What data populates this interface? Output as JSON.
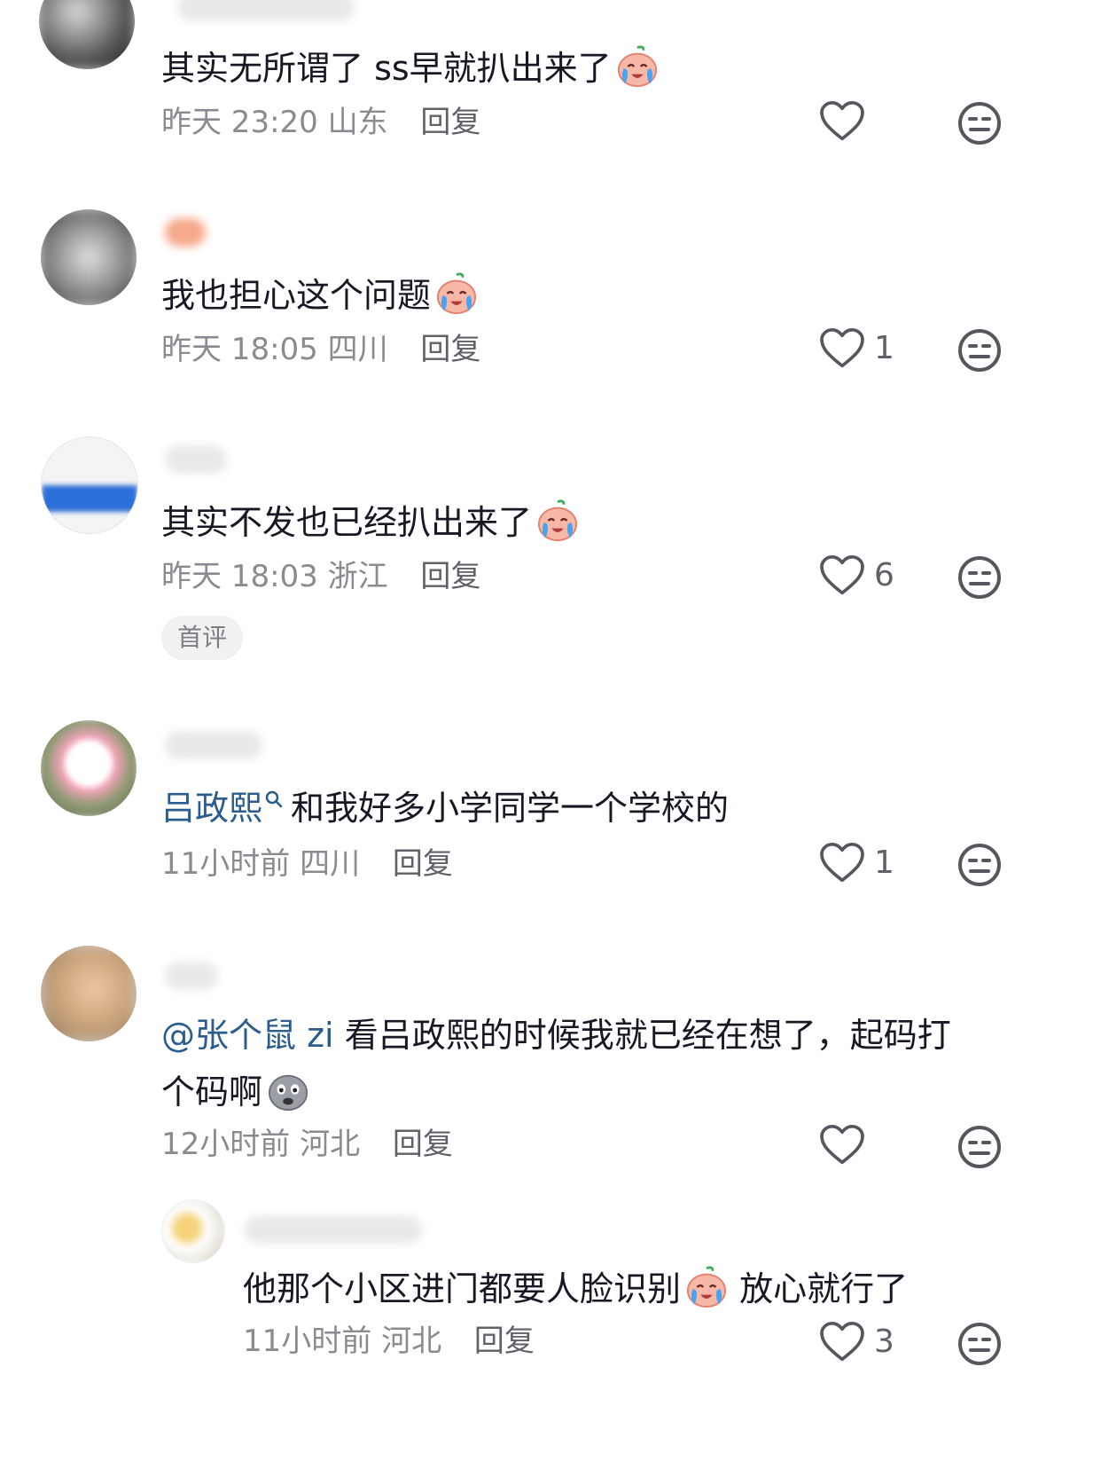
{
  "comments": [
    {
      "text": "其实无所谓了 ss早就扒出来了",
      "time": "昨天 23:20",
      "location": "山东",
      "reply_label": "回复",
      "likes": ""
    },
    {
      "text": "我也担心这个问题",
      "time": "昨天 18:05",
      "location": "四川",
      "reply_label": "回复",
      "likes": "1"
    },
    {
      "text": "其实不发也已经扒出来了",
      "time": "昨天 18:03",
      "location": "浙江",
      "reply_label": "回复",
      "likes": "6",
      "badge": "首评"
    },
    {
      "mention": "吕政熙",
      "text": "和我好多小学同学一个学校的",
      "time": "11小时前",
      "location": "四川",
      "reply_label": "回复",
      "likes": "1"
    },
    {
      "mention": "@张个鼠 zi",
      "text_line1": "看吕政熙的时候我就已经在想了，起码打",
      "text_line2": "个码啊",
      "time": "12小时前",
      "location": "河北",
      "reply_label": "回复",
      "likes": ""
    },
    {
      "text": "他那个小区进门都要人脸识别",
      "text_after_emoji": "放心就行了",
      "time": "11小时前",
      "location": "河北",
      "reply_label": "回复",
      "likes": "3"
    }
  ],
  "icons": {
    "like": "heart-outline-icon",
    "dislike": "neutral-face-icon",
    "search_hint": "search-icon",
    "emoji_crying": "crying-peach-emoji",
    "emoji_worried": "worried-face-emoji"
  },
  "colors": {
    "text": "#161823",
    "meta": "#8a8b91",
    "mention": "#2b5c8e"
  }
}
